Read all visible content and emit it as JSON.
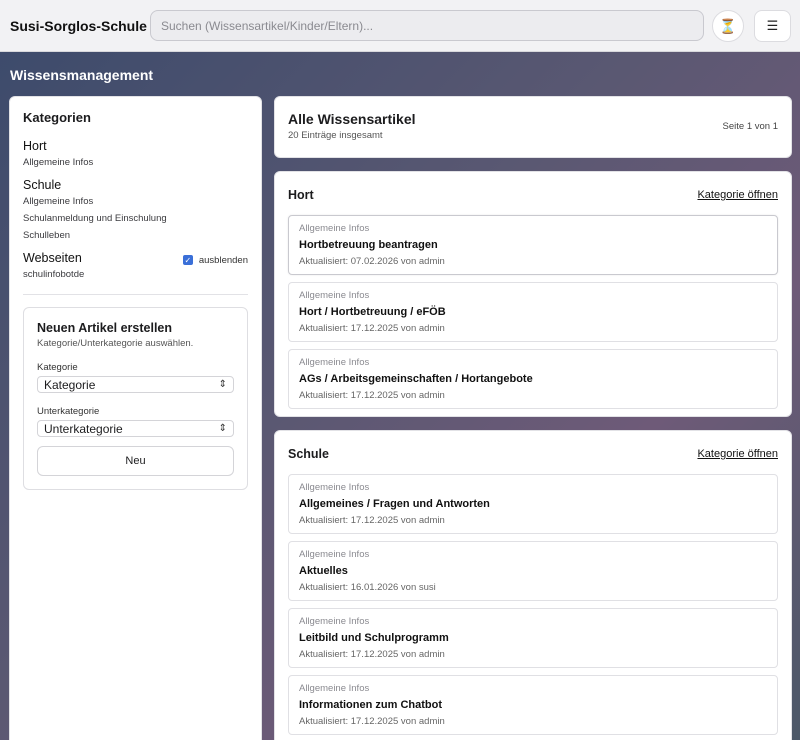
{
  "app": {
    "title": "Susi-Sorglos-Schule",
    "search_placeholder": "Suchen (Wissensartikel/Kinder/Eltern)...",
    "hourglass_glyph": "⏳",
    "menu_glyph": "☰"
  },
  "page": {
    "heading": "Wissensmanagement"
  },
  "sidebar": {
    "title": "Kategorien",
    "groups": [
      {
        "name": "Hort",
        "subs": [
          "Allgemeine Infos"
        ]
      },
      {
        "name": "Schule",
        "subs": [
          "Allgemeine Infos",
          "Schulanmeldung und Einschulung",
          "Schulleben"
        ]
      },
      {
        "name": "Webseiten",
        "subs": [
          "schulinfobotde"
        ],
        "hide_label": "ausblenden",
        "hide_checked": true
      }
    ],
    "new_article": {
      "title": "Neuen Artikel erstellen",
      "subtitle": "Kategorie/Unterkategorie auswählen.",
      "category_label": "Kategorie",
      "category_value": "Kategorie",
      "subcategory_label": "Unterkategorie",
      "subcategory_value": "Unterkategorie",
      "button_label": "Neu"
    }
  },
  "summary": {
    "title": "Alle Wissensartikel",
    "count": "20 Einträge insgesamt",
    "page_info": "Seite 1 von 1"
  },
  "sections": [
    {
      "title": "Hort",
      "link": "Kategorie öffnen",
      "articles": [
        {
          "category": "Allgemeine Infos",
          "title": "Hortbetreuung beantragen",
          "meta": "Aktualisiert: 07.02.2026 von admin"
        },
        {
          "category": "Allgemeine Infos",
          "title": "Hort / Hortbetreuung / eFÖB",
          "meta": "Aktualisiert: 17.12.2025 von admin"
        },
        {
          "category": "Allgemeine Infos",
          "title": "AGs / Arbeitsgemeinschaften / Hortangebote",
          "meta": "Aktualisiert: 17.12.2025 von admin"
        }
      ]
    },
    {
      "title": "Schule",
      "link": "Kategorie öffnen",
      "articles": [
        {
          "category": "Allgemeine Infos",
          "title": "Allgemeines / Fragen und Antworten",
          "meta": "Aktualisiert: 17.12.2025 von admin"
        },
        {
          "category": "Allgemeine Infos",
          "title": "Aktuelles",
          "meta": "Aktualisiert: 16.01.2026 von susi"
        },
        {
          "category": "Allgemeine Infos",
          "title": "Leitbild und Schulprogramm",
          "meta": "Aktualisiert: 17.12.2025 von admin"
        },
        {
          "category": "Allgemeine Infos",
          "title": "Informationen zum Chatbot",
          "meta": "Aktualisiert: 17.12.2025 von admin"
        }
      ]
    }
  ]
}
